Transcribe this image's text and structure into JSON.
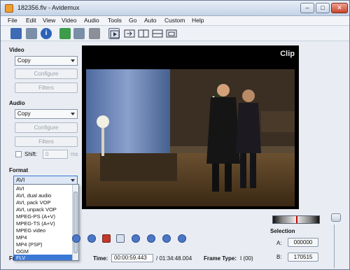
{
  "window": {
    "title": "182356.flv - Avidemux"
  },
  "menu": [
    "File",
    "Edit",
    "View",
    "Video",
    "Audio",
    "Tools",
    "Go",
    "Auto",
    "Custom",
    "Help"
  ],
  "video": {
    "label": "Video",
    "codec": "Copy",
    "configure_label": "Configure",
    "filters_label": "Filters"
  },
  "audio": {
    "label": "Audio",
    "codec": "Copy",
    "configure_label": "Configure",
    "filters_label": "Filters",
    "shift_label": "Shift:",
    "shift_value": "0",
    "shift_unit": "ms"
  },
  "format": {
    "label": "Format",
    "selected": "AVI",
    "options": [
      "AVI",
      "AVI, dual audio",
      "AVI, pack VOP",
      "AVI, unpack VOP",
      "MPEG-PS (A+V)",
      "MPEG-TS (A+V)",
      "MPEG video",
      "MP4",
      "MP4 (PSP)",
      "OGM",
      "FLV"
    ],
    "highlighted": "FLV"
  },
  "player": {
    "logo": "Clip",
    "frame_label": "Fr",
    "time_label": "Time:",
    "time_value": "00:00:59.443",
    "total_time": "/ 01:34:48.004",
    "frame_type_label": "Frame Type:",
    "frame_type_value": "I (00)"
  },
  "selection": {
    "label": "Selection",
    "a_label": "A:",
    "a_value": "000000",
    "b_label": "B:",
    "b_value": "170515"
  }
}
